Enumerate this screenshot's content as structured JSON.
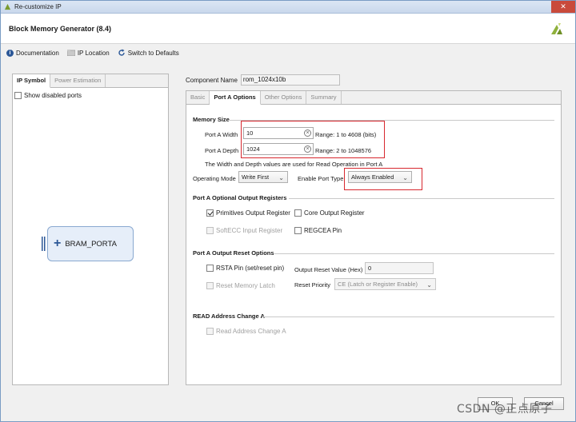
{
  "window": {
    "title": "Re-customize IP"
  },
  "header": {
    "title": "Block Memory Generator (8.4)"
  },
  "toolbar": {
    "documentation": "Documentation",
    "ip_location": "IP Location",
    "switch_defaults": "Switch to Defaults"
  },
  "left": {
    "tabs": [
      "IP Symbol",
      "Power Estimation"
    ],
    "show_disabled_ports": "Show disabled ports",
    "symbol_label": "BRAM_PORTA"
  },
  "component": {
    "label": "Component Name",
    "value": "rom_1024x10b"
  },
  "config_tabs": [
    "Basic",
    "Port A Options",
    "Other Options",
    "Summary"
  ],
  "memory_size": {
    "title": "Memory Size",
    "width_label": "Port A Width",
    "width_value": "10",
    "width_range": "Range: 1 to 4608 (bits)",
    "depth_label": "Port A Depth",
    "depth_value": "1024",
    "depth_range": "Range: 2 to 1048576",
    "note": "The Width and Depth values are used for Read Operation in Port A",
    "op_mode_label": "Operating Mode",
    "op_mode_value": "Write First",
    "enable_port_label": "Enable Port Type",
    "enable_port_value": "Always Enabled"
  },
  "optional_regs": {
    "title": "Port A Optional Output Registers",
    "primitives": "Primitives Output Register",
    "core": "Core Output Register",
    "softecc": "SoftECC Input Register",
    "regcea": "REGCEA Pin"
  },
  "reset_options": {
    "title": "Port A Output Reset Options",
    "rsta": "RSTA Pin (set/reset pin)",
    "reset_value_label": "Output Reset Value (Hex)",
    "reset_value": "0",
    "reset_latch": "Reset Memory Latch",
    "priority_label": "Reset Priority",
    "priority_value": "CE (Latch or Register Enable)"
  },
  "read_addr": {
    "title": "READ Address Change A",
    "checkbox": "Read Address Change A"
  },
  "buttons": {
    "ok": "OK",
    "cancel": "Cancel"
  },
  "watermark": "CSDN @正点原子",
  "colors": {
    "highlight_box": "#d7282f",
    "accent": "#2b5797"
  }
}
